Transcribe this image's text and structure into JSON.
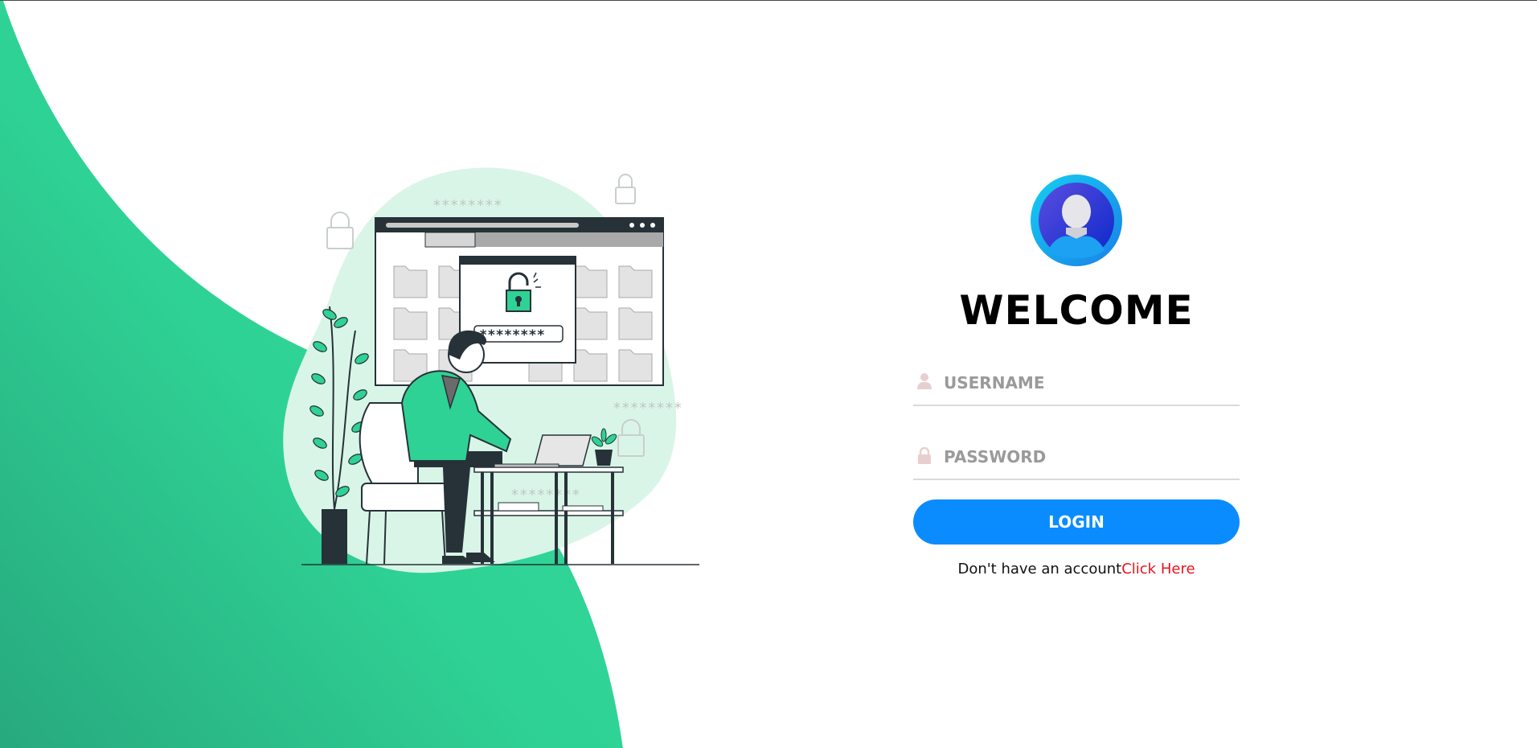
{
  "colors": {
    "accent_green": "#2fd295",
    "login_button": "#0a8cff",
    "link_red": "#e8141c"
  },
  "illustration": {
    "name": "person-unlocking-computer-illustration",
    "password_mask_text": "********"
  },
  "avatar": {
    "icon": "user-avatar-icon"
  },
  "login": {
    "title": "WELCOME",
    "username": {
      "placeholder": "USERNAME",
      "value": "",
      "icon": "user-icon"
    },
    "password": {
      "placeholder": "PASSWORD",
      "value": "",
      "icon": "lock-icon"
    },
    "submit_label": "LOGIN",
    "signup_prompt": "Don't have an account",
    "signup_link": "Click Here"
  }
}
